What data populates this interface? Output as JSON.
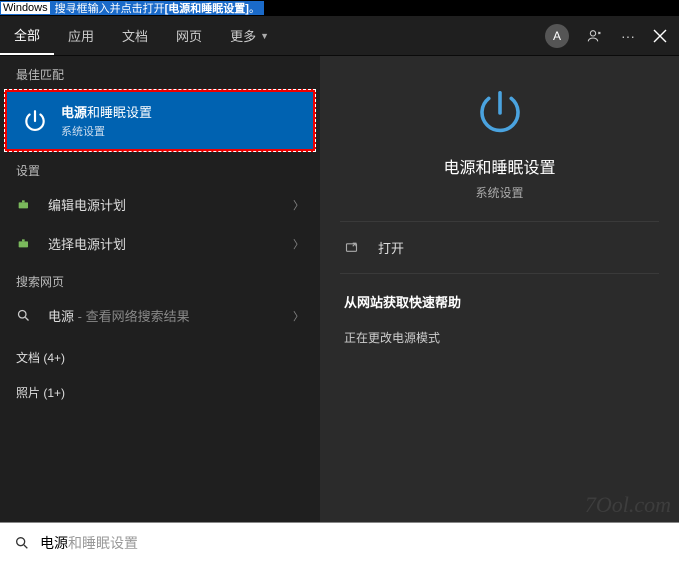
{
  "banner": {
    "box": "Windows",
    "text_prefix": "搜寻框输入并点击打开",
    "text_bracket": "[电源和睡眠设置]"
  },
  "topbar": {
    "tabs": [
      "全部",
      "应用",
      "文档",
      "网页",
      "更多"
    ],
    "avatar_letter": "A"
  },
  "left": {
    "best_match_label": "最佳匹配",
    "best_match": {
      "title_bold": "电源",
      "title_rest": "和睡眠设置",
      "subtitle": "系统设置"
    },
    "settings_label": "设置",
    "settings_items": [
      {
        "label": "编辑电源计划"
      },
      {
        "label": "选择电源计划"
      }
    ],
    "web_label": "搜索网页",
    "web_item": {
      "bold": "电源",
      "rest": " - 查看网络搜索结果"
    },
    "docs_label": "文档 (4+)",
    "photos_label": "照片 (1+)"
  },
  "right": {
    "title": "电源和睡眠设置",
    "subtitle": "系统设置",
    "open_label": "打开",
    "help_title": "从网站获取快速帮助",
    "help_items": [
      "正在更改电源模式"
    ]
  },
  "search": {
    "typed": "电源",
    "ghost": "和睡眠设置"
  },
  "watermark": "7Ool.com"
}
